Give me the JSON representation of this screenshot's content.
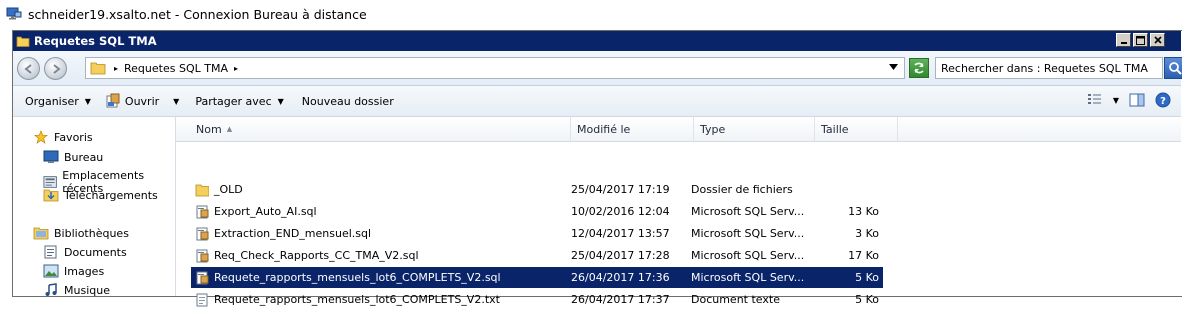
{
  "rdp": {
    "title": "schneider19.xsalto.net - Connexion Bureau à distance"
  },
  "window": {
    "title": "Requetes SQL TMA"
  },
  "address": {
    "crumb": "Requetes SQL TMA"
  },
  "search": {
    "placeholder": "Rechercher dans : Requetes SQL TMA"
  },
  "commands": {
    "organize": "Organiser",
    "open": "Ouvrir",
    "share": "Partager avec",
    "new_folder": "Nouveau dossier"
  },
  "nav": {
    "favorites": "Favoris",
    "items": [
      {
        "label": "Bureau",
        "icon": "desktop-icon"
      },
      {
        "label": "Emplacements récents",
        "icon": "recent-places-icon"
      },
      {
        "label": "Téléchargements",
        "icon": "downloads-icon"
      }
    ],
    "libraries": "Bibliothèques",
    "lib_items": [
      {
        "label": "Documents",
        "icon": "documents-icon"
      },
      {
        "label": "Images",
        "icon": "images-icon"
      },
      {
        "label": "Musique",
        "icon": "music-icon"
      }
    ]
  },
  "columns": {
    "name": "Nom",
    "modified": "Modifié le",
    "type": "Type",
    "size": "Taille"
  },
  "files": [
    {
      "name": "_OLD",
      "modified": "25/04/2017 17:19",
      "type": "Dossier de fichiers",
      "size": "",
      "icon": "folder-icon"
    },
    {
      "name": "Export_Auto_AI.sql",
      "modified": "10/02/2016 12:04",
      "type": "Microsoft SQL Serv...",
      "size": "13 Ko",
      "icon": "sql-file-icon"
    },
    {
      "name": "Extraction_END_mensuel.sql",
      "modified": "12/04/2017 13:57",
      "type": "Microsoft SQL Serv...",
      "size": "3 Ko",
      "icon": "sql-file-icon"
    },
    {
      "name": "Req_Check_Rapports_CC_TMA_V2.sql",
      "modified": "25/04/2017 17:28",
      "type": "Microsoft SQL Serv...",
      "size": "17 Ko",
      "icon": "sql-file-icon"
    },
    {
      "name": "Requete_rapports_mensuels_lot6_COMPLETS_V2.sql",
      "modified": "26/04/2017 17:36",
      "type": "Microsoft SQL Serv...",
      "size": "5 Ko",
      "icon": "sql-file-icon",
      "selected": true
    },
    {
      "name": "Requete_rapports_mensuels_lot6_COMPLETS_V2.txt",
      "modified": "26/04/2017 17:37",
      "type": "Document texte",
      "size": "5 Ko",
      "icon": "text-file-icon"
    }
  ],
  "colors": {
    "selection": "#0a246a",
    "titlebar": "#0a246a"
  }
}
